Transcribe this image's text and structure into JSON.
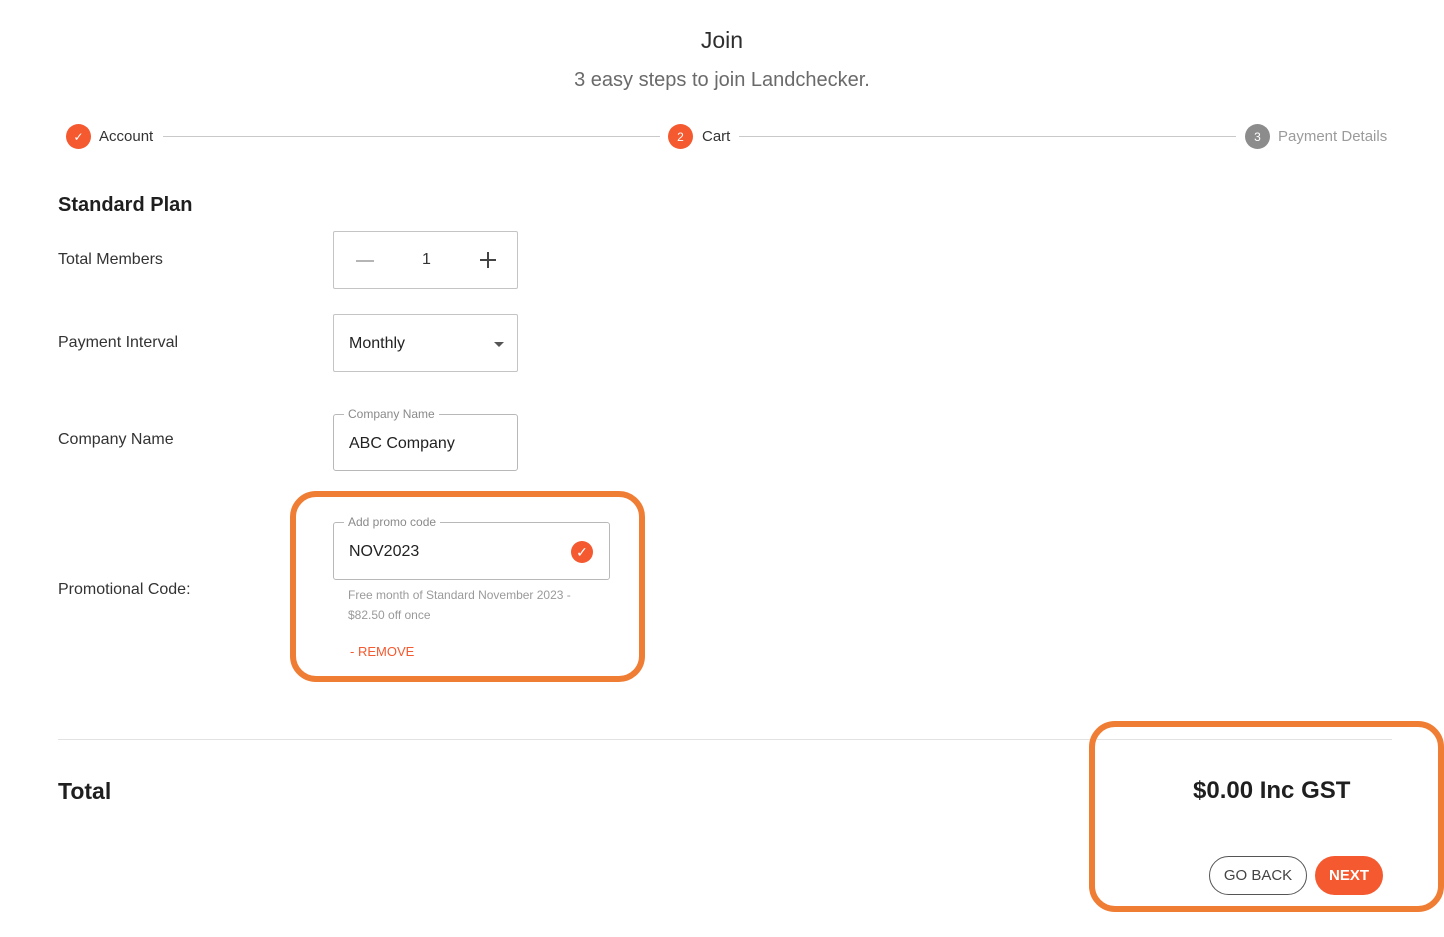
{
  "header": {
    "title": "Join",
    "subtitle": "3 easy steps to join Landchecker."
  },
  "steps": [
    {
      "label": "Account",
      "status": "done",
      "icon": "check-icon"
    },
    {
      "label": "Cart",
      "status": "active",
      "number": "2"
    },
    {
      "label": "Payment Details",
      "status": "pending",
      "number": "3"
    }
  ],
  "plan": {
    "title": "Standard Plan",
    "members": {
      "label": "Total Members",
      "value": "1"
    },
    "interval": {
      "label": "Payment Interval",
      "value": "Monthly"
    },
    "company": {
      "label": "Company Name",
      "float_label": "Company Name",
      "value": "ABC Company"
    },
    "promo": {
      "label": "Promotional Code:",
      "float_label": "Add promo code",
      "value": "NOV2023",
      "description": "Free month of Standard November 2023 - $82.50 off once",
      "remove_label": "- REMOVE"
    }
  },
  "summary": {
    "total_label": "Total",
    "total_value": "$0.00 Inc GST"
  },
  "actions": {
    "back_label": "GO BACK",
    "next_label": "NEXT"
  },
  "colors": {
    "accent": "#f4592f",
    "highlight": "#ef7d34",
    "pending": "#8c8c8c"
  }
}
